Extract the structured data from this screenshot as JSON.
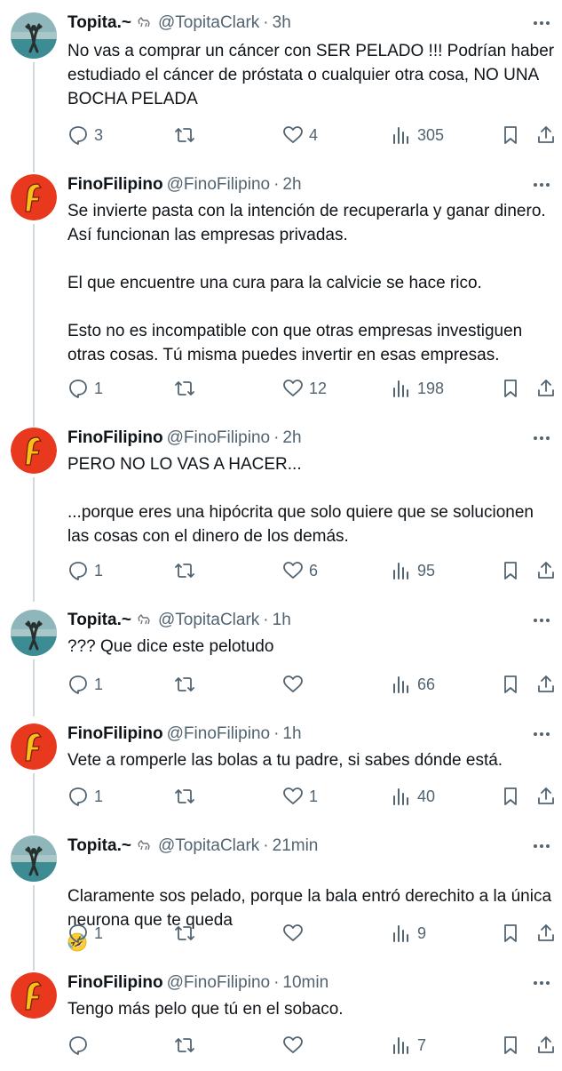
{
  "tweets": [
    {
      "author": "topita",
      "name": "Topita.~",
      "badge_icon": "dog-icon",
      "handle": "@TopitaClark",
      "time": "3h",
      "text": "No vas a comprar un cáncer con SER PELADO !!! Podrían haber estudiado el cáncer de próstata o cualquier otra cosa, NO UNA BOCHA PELADA",
      "replies": "3",
      "reposts": "",
      "likes": "4",
      "views": "305"
    },
    {
      "author": "fino",
      "name": "FinoFilipino",
      "handle": "@FinoFilipino",
      "time": "2h",
      "text": "Se invierte pasta con la intención de recuperarla y ganar dinero. Así funcionan las empresas privadas.\n\nEl que encuentre una cura para la calvicie se hace rico.\n\nEsto no es incompatible con que otras empresas investiguen otras cosas. Tú misma puedes invertir en esas empresas.",
      "replies": "1",
      "reposts": "",
      "likes": "12",
      "views": "198"
    },
    {
      "author": "fino",
      "name": "FinoFilipino",
      "handle": "@FinoFilipino",
      "time": "2h",
      "text": "PERO NO LO VAS A HACER...\n\n...porque eres una hipócrita que solo quiere que se solucionen las cosas con el dinero de los demás.",
      "replies": "1",
      "reposts": "",
      "likes": "6",
      "views": "95"
    },
    {
      "author": "topita",
      "name": "Topita.~",
      "badge_icon": "dog-icon",
      "handle": "@TopitaClark",
      "time": "1h",
      "text": "??? Que dice este pelotudo",
      "replies": "1",
      "reposts": "",
      "likes": "",
      "views": "66"
    },
    {
      "author": "fino",
      "name": "FinoFilipino",
      "handle": "@FinoFilipino",
      "time": "1h",
      "text": "Vete a romperle las bolas a tu padre, si sabes dónde está.",
      "replies": "1",
      "reposts": "",
      "likes": "1",
      "views": "40"
    },
    {
      "author": "topita",
      "name": "Topita.~",
      "badge_icon": "dog-icon",
      "handle": "@TopitaClark",
      "time": "21min",
      "text": "Claramente sos pelado, porque la bala entró derechito a la única neurona que te queda",
      "emoji": "rolling-on-floor-laughing-emoji",
      "replies": "1",
      "reposts": "",
      "likes": "",
      "views": "9"
    },
    {
      "author": "fino",
      "name": "FinoFilipino",
      "handle": "@FinoFilipino",
      "time": "10min",
      "text": "Tengo más pelo que tú en el sobaco.",
      "replies": "",
      "reposts": "",
      "likes": "",
      "views": "7"
    }
  ],
  "ui": {
    "separator": "·",
    "icons": {
      "reply": "reply-icon",
      "repost": "repost-icon",
      "like": "heart-icon",
      "views": "views-icon",
      "bookmark": "bookmark-icon",
      "share": "share-icon",
      "more": "more-icon"
    },
    "colors": {
      "text": "#0f1419",
      "muted": "#536471",
      "thread_line": "#cfd9de",
      "fino_avatar_bg": "#e8391f",
      "fino_avatar_letter": "#f6c21a"
    }
  }
}
